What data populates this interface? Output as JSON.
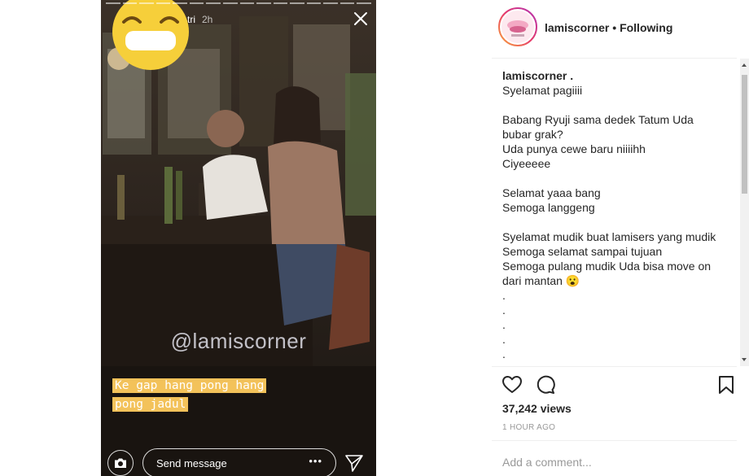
{
  "story": {
    "username": "tri",
    "time": "2h",
    "watermark": "@lamiscorner",
    "caption_lines": [
      "Ke gap hang pong hang",
      "pong jadul"
    ],
    "send_placeholder": "Send message",
    "more_label": "•••",
    "icons": [
      "close-icon",
      "camera-icon",
      "send-icon",
      "more-icon",
      "grimace-emoji-sticker"
    ]
  },
  "post": {
    "header": {
      "username": "lamiscorner",
      "separator": " • ",
      "follow_status": "Following"
    },
    "caption": {
      "author": "lamiscorner .",
      "blocks": [
        [
          "Syelamat pagiiii"
        ],
        [
          "Babang Ryuji sama dedek Tatum Uda",
          "bubar grak?",
          "Uda punya cewe baru niiiihh",
          "Ciyeeeee"
        ],
        [
          "Selamat yaaa bang",
          "Semoga langgeng"
        ],
        [
          "Syelamat mudik buat lamisers yang mudik",
          "Semoga selamat sampai tujuan",
          "Semoga pulang mudik Uda bisa move on",
          "dari mantan 😮",
          ".",
          ".",
          ".",
          ".",
          ".",
          "."
        ]
      ]
    },
    "views": "37,242 views",
    "timestamp": "1 HOUR AGO",
    "add_comment_placeholder": "Add a comment...",
    "colors": {
      "text": "#262626",
      "muted": "#999999",
      "divider": "#efefef",
      "sticker": "#f6cf3a",
      "caption_highlight": "#f3c25a"
    }
  }
}
